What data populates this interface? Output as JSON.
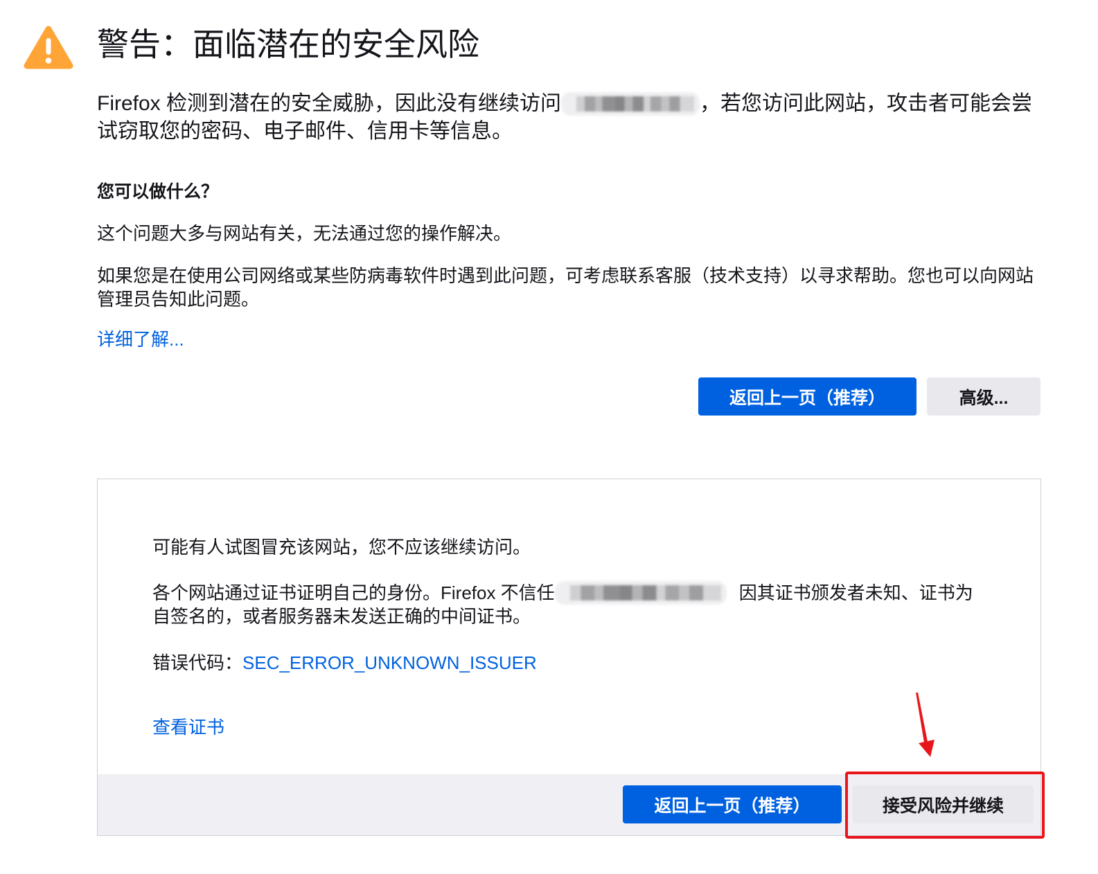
{
  "theme": {
    "warning_icon_color": "#FFA436",
    "primary_color": "#0061E0",
    "link_color": "#0061E0",
    "text_color": "#15141A",
    "secondary_button_color": "#E9E9ED",
    "panel_footer_color": "#F0F0F4",
    "panel_border_color": "#CFCFD8",
    "annotation_color": "#E8161B"
  },
  "warning": {
    "icon": "warning-triangle-icon",
    "title": "警告：面临潜在的安全风险",
    "intro": {
      "before_hostname": "Firefox 检测到潜在的安全威胁，因此没有继续访问",
      "after_hostname": "，若您访问此网站，攻击者可能会尝试窃取您的密码、电子邮件、信用卡等信息。"
    },
    "what_can_you_do": {
      "heading": "您可以做什么？",
      "paragraphs": [
        "这个问题大多与网站有关，无法通过您的操作解决。",
        "如果您是在使用公司网络或某些防病毒软件时遇到此问题，可考虑联系客服（技术支持）以寻求帮助。您也可以向网站管理员告知此问题。"
      ]
    },
    "learn_more_link": "详细了解...",
    "buttons": {
      "go_back": "返回上一页（推荐）",
      "advanced": "高级..."
    }
  },
  "advanced_panel": {
    "impersonation_text": "可能有人试图冒充该网站，您不应该继续访问。",
    "certificate_text": {
      "before_hostname": "各个网站通过证书证明自己的身份。Firefox 不信任",
      "after_hostname": "因其证书颁发者未知、证书为自签名的，或者服务器未发送正确的中间证书。"
    },
    "error_code_label": "错误代码：",
    "error_code": "SEC_ERROR_UNKNOWN_ISSUER",
    "view_certificate_link": "查看证书",
    "buttons": {
      "go_back": "返回上一页（推荐）",
      "accept_risk": "接受风险并继续"
    }
  }
}
